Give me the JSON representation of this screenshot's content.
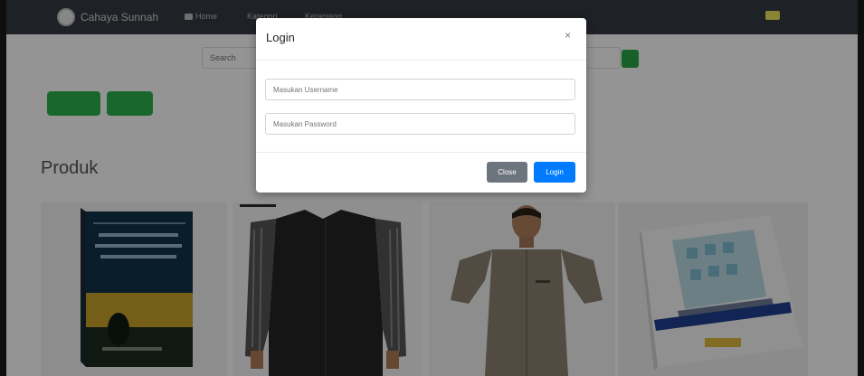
{
  "navbar": {
    "brand": "Cahaya Sunnah",
    "links": [
      {
        "label": "Home",
        "icon": "home-icon"
      },
      {
        "label": "Kategori"
      },
      {
        "label": "Keranjang"
      }
    ]
  },
  "search": {
    "placeholder": "Search"
  },
  "products": {
    "heading": "Produk"
  },
  "modal": {
    "title": "Login",
    "close_symbol": "×",
    "username_placeholder": "Masukan Username",
    "password_placeholder": "Masukan Password",
    "close_button": "Close",
    "login_button": "Login"
  },
  "colors": {
    "navbar": "#343a40",
    "accent_green": "#28a745",
    "primary_blue": "#007bff",
    "secondary_gray": "#6c757d"
  }
}
